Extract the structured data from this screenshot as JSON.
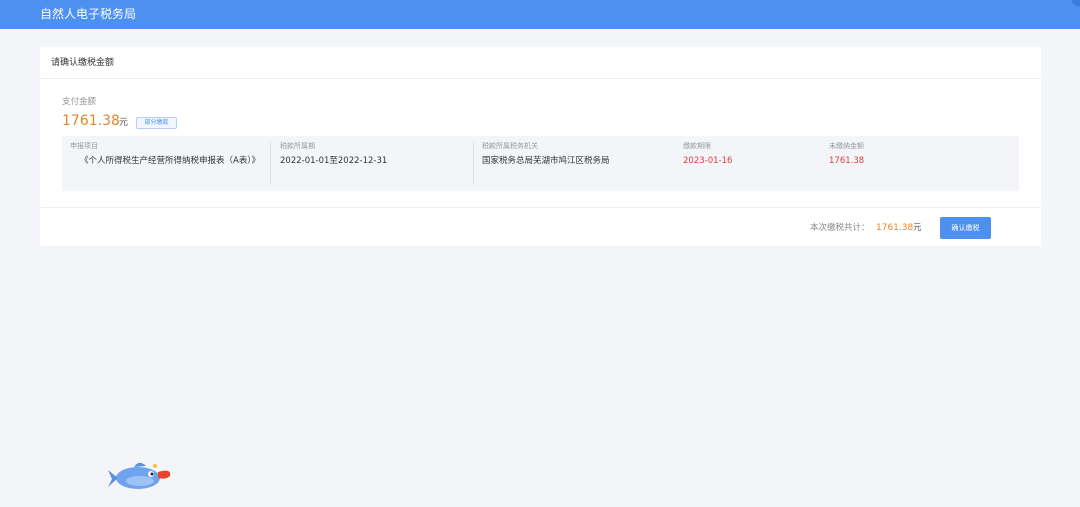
{
  "header": {
    "title": "自然人电子税务局"
  },
  "card": {
    "title": "请确认缴税金额",
    "pay_label": "支付金额",
    "amount": "1761.38",
    "amount_unit": "元",
    "partial_button": "部分缴款",
    "detail": {
      "columns": [
        {
          "label": "申报项目",
          "value": "《个人所得税生产经营所得纳税申报表（A表）》"
        },
        {
          "label": "税款所属期",
          "value": "2022-01-01至2022-12-31"
        },
        {
          "label": "税款所属税务机关",
          "value": "国家税务总局芜湖市鸠江区税务局"
        },
        {
          "label": "缴款期限",
          "value": "2023-01-16"
        },
        {
          "label": "未缴纳金额",
          "value": "1761.38"
        }
      ]
    },
    "footer": {
      "total_label": "本次缴税共计：",
      "total_amount": "1761.38",
      "total_unit": "元",
      "confirm_button": "确认缴税"
    }
  },
  "colors": {
    "primary": "#4d90f0",
    "amount": "#e7842c",
    "deadline": "#e23b3b"
  },
  "icons": {
    "mascot": "fish-mascot-icon"
  }
}
